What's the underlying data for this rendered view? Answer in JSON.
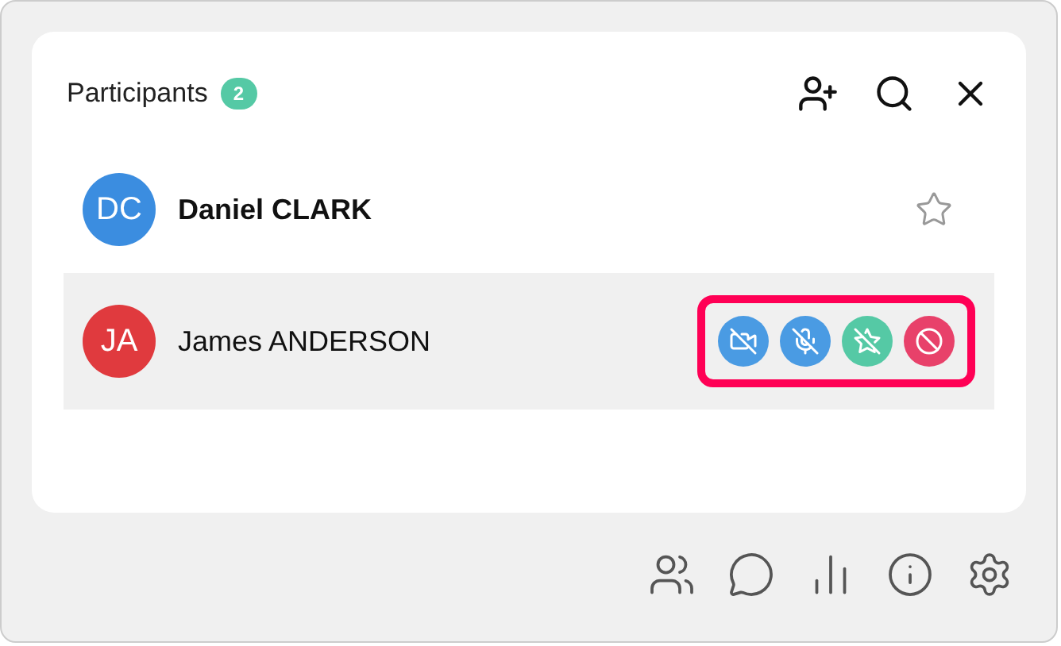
{
  "panel": {
    "title": "Participants",
    "count": "2"
  },
  "participants": [
    {
      "initials": "DC",
      "name": "Daniel CLARK",
      "color": "#3b8de0",
      "emphasized": true,
      "selected": false,
      "favorite": false
    },
    {
      "initials": "JA",
      "name": "James ANDERSON",
      "color": "#e03a3e",
      "emphasized": false,
      "selected": true,
      "actions_highlighted": true,
      "actions": [
        {
          "kind": "camera-off",
          "color": "#4a9be3"
        },
        {
          "kind": "mic-off",
          "color": "#4a9be3"
        },
        {
          "kind": "star-off",
          "color": "#55c9a5"
        },
        {
          "kind": "ban",
          "color": "#e8416a"
        }
      ]
    }
  ]
}
